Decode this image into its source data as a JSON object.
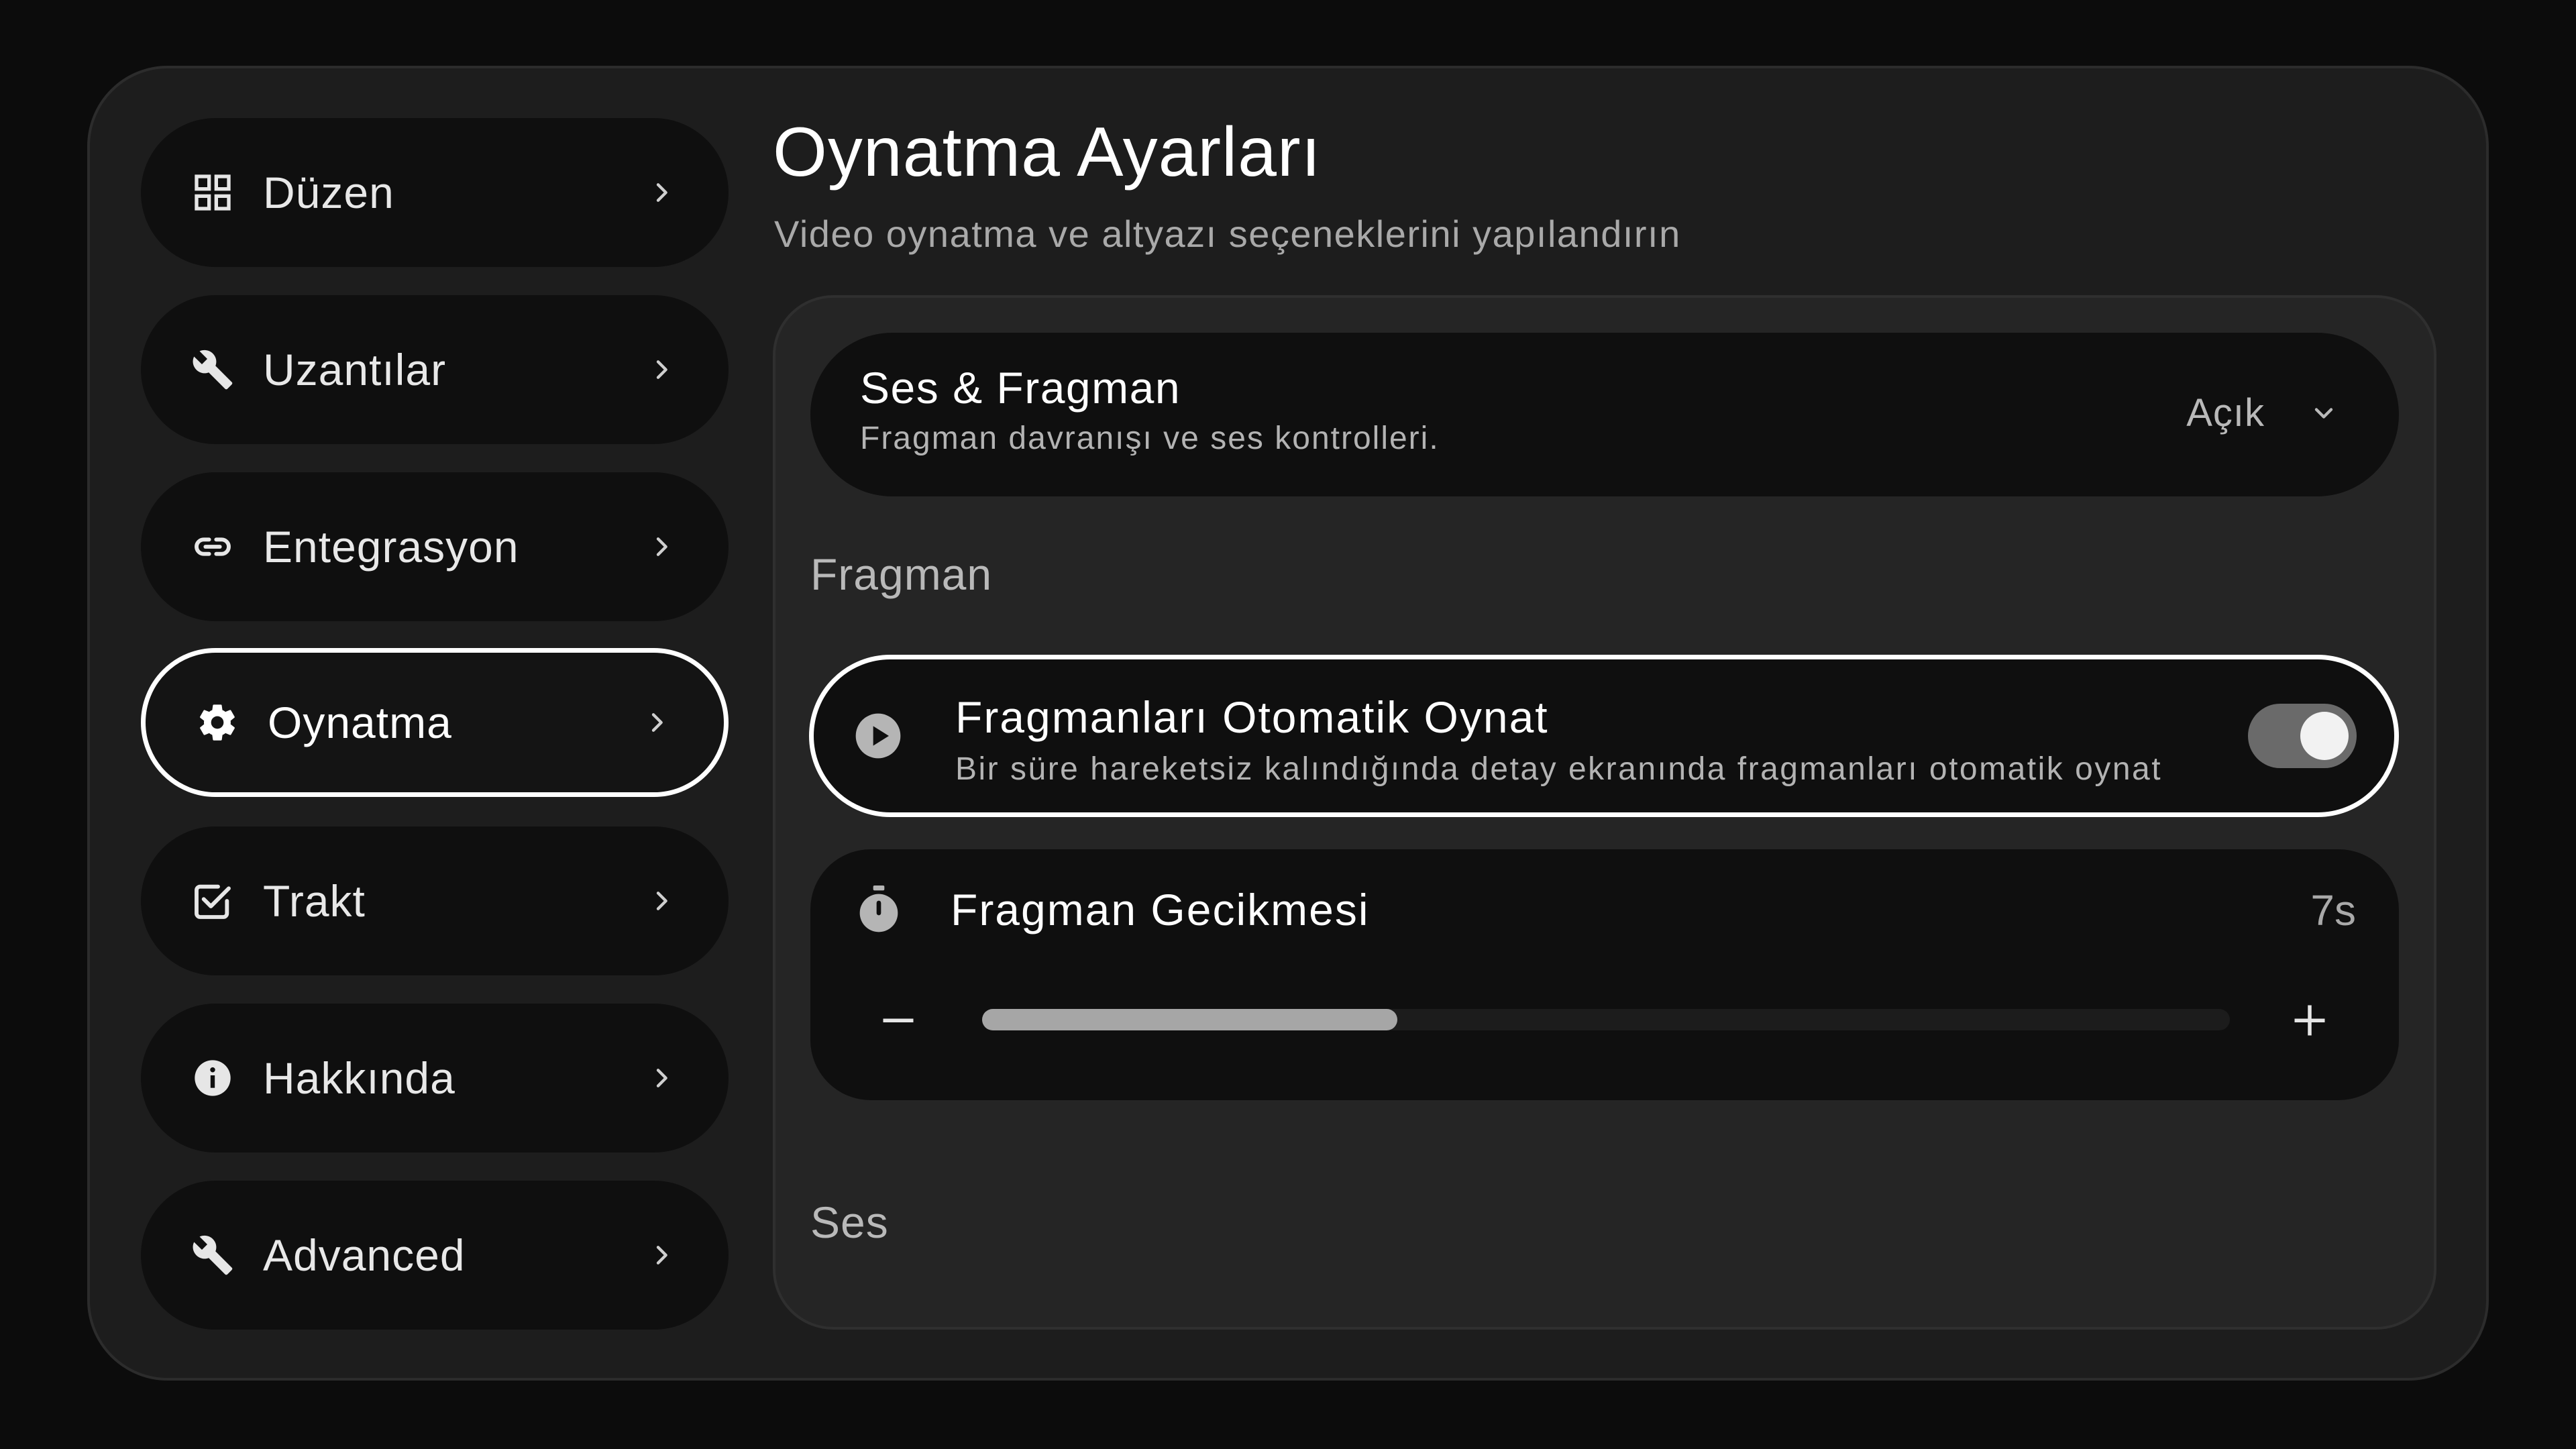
{
  "sidebar": {
    "items": [
      {
        "label": "Düzen",
        "icon": "grid-icon",
        "active": false
      },
      {
        "label": "Uzantılar",
        "icon": "wrench-icon",
        "active": false
      },
      {
        "label": "Entegrasyon",
        "icon": "link-icon",
        "active": false
      },
      {
        "label": "Oynatma",
        "icon": "gear-icon",
        "active": true
      },
      {
        "label": "Trakt",
        "icon": "checkbox-icon",
        "active": false
      },
      {
        "label": "Hakkında",
        "icon": "info-icon",
        "active": false
      },
      {
        "label": "Advanced",
        "icon": "wrench-icon",
        "active": false
      }
    ]
  },
  "header": {
    "title": "Oynatma Ayarları",
    "subtitle": "Video oynatma ve altyazı seçeneklerini yapılandırın"
  },
  "section": {
    "title": "Ses & Fragman",
    "description": "Fragman davranışı ve ses kontrolleri.",
    "status": "Açık"
  },
  "groups": {
    "trailer_label": "Fragman",
    "audio_label": "Ses"
  },
  "autoplay": {
    "title": "Fragmanları Otomatik Oynat",
    "description": "Bir süre hareketsiz kalındığında detay ekranında fragmanları otomatik oynat",
    "enabled": true
  },
  "delay": {
    "title": "Fragman Gecikmesi",
    "value": "7s",
    "slider_fraction": 0.333
  },
  "colors": {
    "background": "#0c0c0c",
    "panel": "#1d1d1d",
    "card": "#252525",
    "row": "#0f0f0f",
    "accent": "#ffffff",
    "muted_text": "#b3b3b3"
  }
}
